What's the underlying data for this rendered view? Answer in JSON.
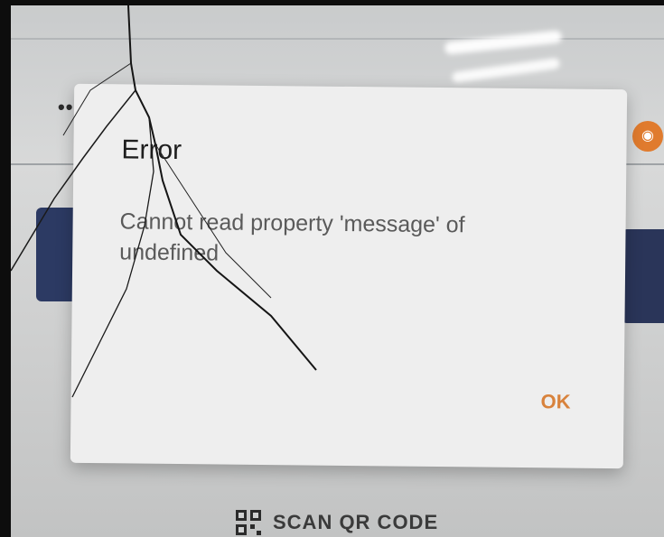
{
  "login": {
    "password_mask": "•••",
    "eye_icon": "eye-icon",
    "accent_color": "#e07b2e",
    "primary_color": "#2c3a63"
  },
  "dialog": {
    "title": "Error",
    "message": "Cannot read property 'message' of undefined",
    "ok_label": "OK",
    "ok_color": "#d8823c"
  },
  "footer": {
    "scan_label": "SCAN QR CODE",
    "scan_icon": "qr-code-icon"
  }
}
